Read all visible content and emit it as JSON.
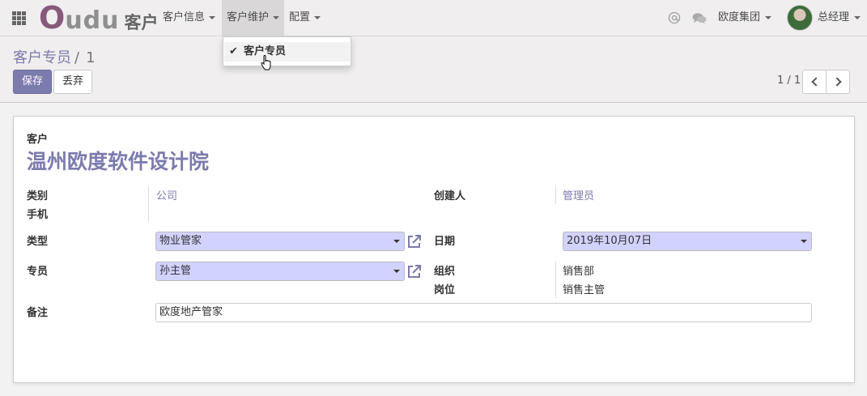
{
  "navbar": {
    "brand_o": "O",
    "brand_rest": "udu",
    "app_name": "客户",
    "menus": [
      {
        "label": "客户信息"
      },
      {
        "label": "客户维护"
      },
      {
        "label": "配置"
      }
    ],
    "at_icon": "at-icon",
    "chat_icon": "chat-icon",
    "company": "欧度集团",
    "user": "总经理"
  },
  "dropdown": {
    "items": [
      {
        "label": "客户专员",
        "checked": true
      }
    ]
  },
  "control_panel": {
    "breadcrumb_parent": "客户专员",
    "breadcrumb_sep": "/",
    "breadcrumb_current": "1",
    "save_label": "保存",
    "discard_label": "丢弃",
    "pager_value": "1 / 1"
  },
  "form": {
    "customer_label": "客户",
    "customer_name": "温州欧度软件设计院",
    "category_label": "类别",
    "category_value": "公司",
    "mobile_label": "手机",
    "creator_label": "创建人",
    "creator_value": "管理员",
    "type_label": "类型",
    "type_value": "物业管家",
    "date_label": "日期",
    "date_value": "2019年10月07日",
    "agent_label": "专员",
    "agent_value": "孙主管",
    "org_label": "组织",
    "org_value": "销售部",
    "position_label": "岗位",
    "position_value": "销售主管",
    "note_label": "备注",
    "note_value": "欧度地产管家"
  },
  "colors": {
    "accent": "#7c7bad",
    "brand": "#875a7b",
    "select_bg": "#d2d2ff"
  }
}
